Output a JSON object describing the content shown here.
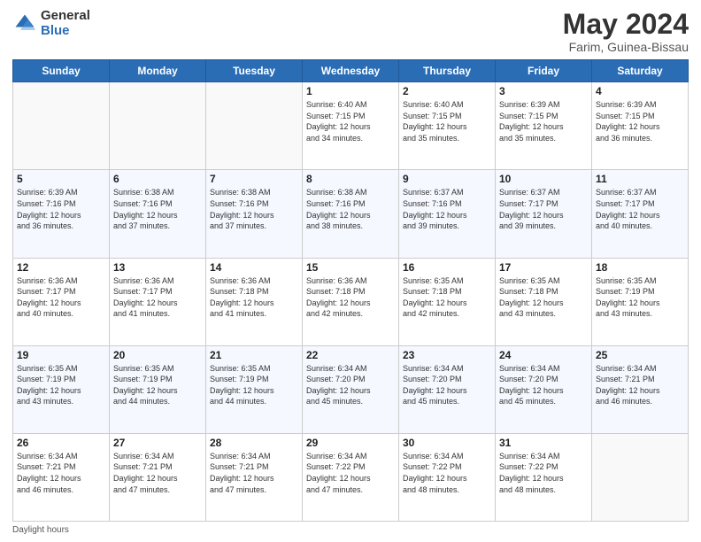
{
  "header": {
    "logo_general": "General",
    "logo_blue": "Blue",
    "title": "May 2024",
    "location": "Farim, Guinea-Bissau"
  },
  "weekdays": [
    "Sunday",
    "Monday",
    "Tuesday",
    "Wednesday",
    "Thursday",
    "Friday",
    "Saturday"
  ],
  "weeks": [
    [
      {
        "day": "",
        "info": ""
      },
      {
        "day": "",
        "info": ""
      },
      {
        "day": "",
        "info": ""
      },
      {
        "day": "1",
        "info": "Sunrise: 6:40 AM\nSunset: 7:15 PM\nDaylight: 12 hours\nand 34 minutes."
      },
      {
        "day": "2",
        "info": "Sunrise: 6:40 AM\nSunset: 7:15 PM\nDaylight: 12 hours\nand 35 minutes."
      },
      {
        "day": "3",
        "info": "Sunrise: 6:39 AM\nSunset: 7:15 PM\nDaylight: 12 hours\nand 35 minutes."
      },
      {
        "day": "4",
        "info": "Sunrise: 6:39 AM\nSunset: 7:15 PM\nDaylight: 12 hours\nand 36 minutes."
      }
    ],
    [
      {
        "day": "5",
        "info": "Sunrise: 6:39 AM\nSunset: 7:16 PM\nDaylight: 12 hours\nand 36 minutes."
      },
      {
        "day": "6",
        "info": "Sunrise: 6:38 AM\nSunset: 7:16 PM\nDaylight: 12 hours\nand 37 minutes."
      },
      {
        "day": "7",
        "info": "Sunrise: 6:38 AM\nSunset: 7:16 PM\nDaylight: 12 hours\nand 37 minutes."
      },
      {
        "day": "8",
        "info": "Sunrise: 6:38 AM\nSunset: 7:16 PM\nDaylight: 12 hours\nand 38 minutes."
      },
      {
        "day": "9",
        "info": "Sunrise: 6:37 AM\nSunset: 7:16 PM\nDaylight: 12 hours\nand 39 minutes."
      },
      {
        "day": "10",
        "info": "Sunrise: 6:37 AM\nSunset: 7:17 PM\nDaylight: 12 hours\nand 39 minutes."
      },
      {
        "day": "11",
        "info": "Sunrise: 6:37 AM\nSunset: 7:17 PM\nDaylight: 12 hours\nand 40 minutes."
      }
    ],
    [
      {
        "day": "12",
        "info": "Sunrise: 6:36 AM\nSunset: 7:17 PM\nDaylight: 12 hours\nand 40 minutes."
      },
      {
        "day": "13",
        "info": "Sunrise: 6:36 AM\nSunset: 7:17 PM\nDaylight: 12 hours\nand 41 minutes."
      },
      {
        "day": "14",
        "info": "Sunrise: 6:36 AM\nSunset: 7:18 PM\nDaylight: 12 hours\nand 41 minutes."
      },
      {
        "day": "15",
        "info": "Sunrise: 6:36 AM\nSunset: 7:18 PM\nDaylight: 12 hours\nand 42 minutes."
      },
      {
        "day": "16",
        "info": "Sunrise: 6:35 AM\nSunset: 7:18 PM\nDaylight: 12 hours\nand 42 minutes."
      },
      {
        "day": "17",
        "info": "Sunrise: 6:35 AM\nSunset: 7:18 PM\nDaylight: 12 hours\nand 43 minutes."
      },
      {
        "day": "18",
        "info": "Sunrise: 6:35 AM\nSunset: 7:19 PM\nDaylight: 12 hours\nand 43 minutes."
      }
    ],
    [
      {
        "day": "19",
        "info": "Sunrise: 6:35 AM\nSunset: 7:19 PM\nDaylight: 12 hours\nand 43 minutes."
      },
      {
        "day": "20",
        "info": "Sunrise: 6:35 AM\nSunset: 7:19 PM\nDaylight: 12 hours\nand 44 minutes."
      },
      {
        "day": "21",
        "info": "Sunrise: 6:35 AM\nSunset: 7:19 PM\nDaylight: 12 hours\nand 44 minutes."
      },
      {
        "day": "22",
        "info": "Sunrise: 6:34 AM\nSunset: 7:20 PM\nDaylight: 12 hours\nand 45 minutes."
      },
      {
        "day": "23",
        "info": "Sunrise: 6:34 AM\nSunset: 7:20 PM\nDaylight: 12 hours\nand 45 minutes."
      },
      {
        "day": "24",
        "info": "Sunrise: 6:34 AM\nSunset: 7:20 PM\nDaylight: 12 hours\nand 45 minutes."
      },
      {
        "day": "25",
        "info": "Sunrise: 6:34 AM\nSunset: 7:21 PM\nDaylight: 12 hours\nand 46 minutes."
      }
    ],
    [
      {
        "day": "26",
        "info": "Sunrise: 6:34 AM\nSunset: 7:21 PM\nDaylight: 12 hours\nand 46 minutes."
      },
      {
        "day": "27",
        "info": "Sunrise: 6:34 AM\nSunset: 7:21 PM\nDaylight: 12 hours\nand 47 minutes."
      },
      {
        "day": "28",
        "info": "Sunrise: 6:34 AM\nSunset: 7:21 PM\nDaylight: 12 hours\nand 47 minutes."
      },
      {
        "day": "29",
        "info": "Sunrise: 6:34 AM\nSunset: 7:22 PM\nDaylight: 12 hours\nand 47 minutes."
      },
      {
        "day": "30",
        "info": "Sunrise: 6:34 AM\nSunset: 7:22 PM\nDaylight: 12 hours\nand 48 minutes."
      },
      {
        "day": "31",
        "info": "Sunrise: 6:34 AM\nSunset: 7:22 PM\nDaylight: 12 hours\nand 48 minutes."
      },
      {
        "day": "",
        "info": ""
      }
    ]
  ],
  "footer": {
    "daylight_label": "Daylight hours"
  }
}
